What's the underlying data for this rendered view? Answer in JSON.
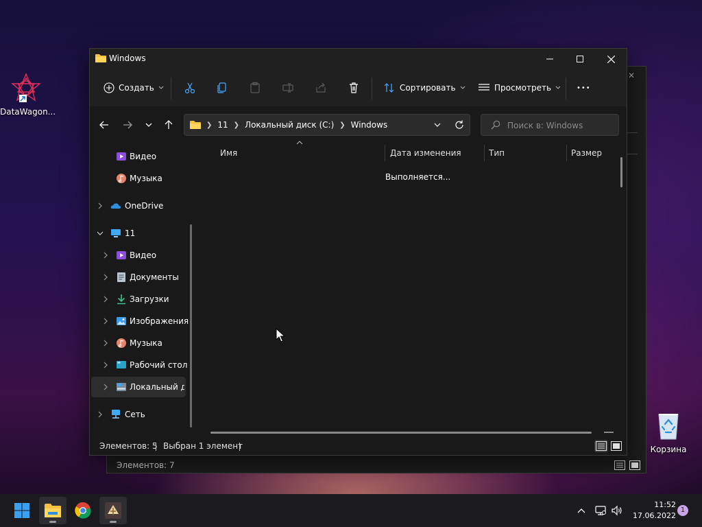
{
  "desktop": {
    "icons": [
      {
        "label": "DataWagon...",
        "icon": "datawagon-shortcut-icon"
      },
      {
        "label": "Корзина",
        "icon": "recycle-bin-icon"
      }
    ]
  },
  "background_window": {
    "status": "Элементов: 7"
  },
  "window": {
    "title": "Windows",
    "controls": {
      "minimize": "minimize-icon",
      "maximize": "maximize-icon",
      "close": "close-icon"
    },
    "toolbar": {
      "create_label": "Создать",
      "sort_label": "Сортировать",
      "view_label": "Просмотреть",
      "more_glyph": "•••"
    },
    "address": {
      "crumbs": [
        "11",
        "Локальный диск (C:)",
        "Windows"
      ]
    },
    "search": {
      "placeholder": "Поиск в: Windows"
    },
    "navpane": {
      "items": [
        {
          "label": "Видео",
          "icon": "video-folder-icon"
        },
        {
          "label": "Музыка",
          "icon": "music-folder-icon"
        },
        {
          "label": "OneDrive",
          "icon": "onedrive-icon"
        },
        {
          "label": "11",
          "icon": "this-pc-icon"
        },
        {
          "label": "Видео",
          "icon": "video-folder-icon"
        },
        {
          "label": "Документы",
          "icon": "documents-folder-icon"
        },
        {
          "label": "Загрузки",
          "icon": "downloads-folder-icon"
        },
        {
          "label": "Изображения",
          "icon": "pictures-folder-icon"
        },
        {
          "label": "Музыка",
          "icon": "music-folder-icon"
        },
        {
          "label": "Рабочий стол",
          "icon": "desktop-folder-icon"
        },
        {
          "label": "Локальный ди",
          "icon": "local-disk-icon"
        },
        {
          "label": "Сеть",
          "icon": "network-icon"
        }
      ]
    },
    "columns": [
      "Имя",
      "Дата изменения",
      "Тип",
      "Размер"
    ],
    "loading_text": "Выполняется...",
    "status": {
      "items_count": "Элементов: 5",
      "selected": "Выбран 1 элемент"
    }
  },
  "taskbar": {
    "apps": [
      "start-icon",
      "file-explorer-icon",
      "chrome-icon",
      "datawagon-app-icon"
    ],
    "clock": {
      "time": "11:52",
      "date": "17.06.2022"
    },
    "notifications": "1"
  },
  "colors": {
    "accent": "#0078d4",
    "window_bg": "#191919",
    "toolbar_bg": "#202020",
    "taskbar_bg": "#1b1b1f"
  }
}
